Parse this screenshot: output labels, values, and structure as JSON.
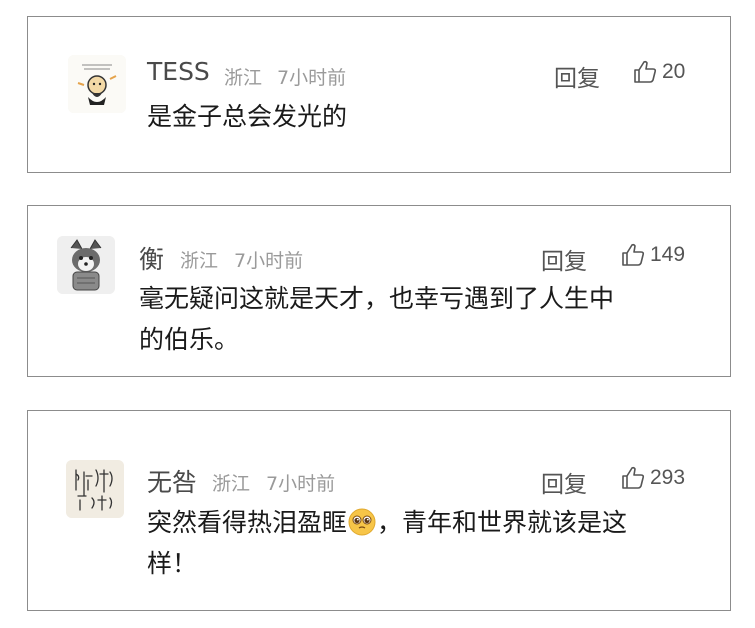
{
  "ui": {
    "reply_label": "回复",
    "like_icon": "thumbs-up-icon",
    "colors": {
      "border": "#8c8c8c",
      "name": "#4a4a4a",
      "meta": "#9a9a9a",
      "text": "#1a1a1a",
      "emoji": "#f7c548"
    }
  },
  "comments": [
    {
      "name": "TESS",
      "location": "浙江",
      "time": "7小时前",
      "likes": "20",
      "avatar_icon": "cartoon-figure-avatar",
      "text_lines": [
        "是金子总会发光的"
      ]
    },
    {
      "name": "衡",
      "location": "浙江",
      "time": "7小时前",
      "likes": "149",
      "avatar_icon": "husky-dog-avatar",
      "text_lines": [
        "毫无疑问这就是天才，也幸亏遇到了人生中",
        "的伯乐。"
      ]
    },
    {
      "name": "无咎",
      "location": "浙江",
      "time": "7小时前",
      "likes": "293",
      "avatar_icon": "calligraphy-avatar",
      "text_lines": [
        "突然看得热泪盈眶",
        "，青年和世界就该是这",
        "样！"
      ],
      "emoji_icon": "pleading-face-emoji-icon"
    }
  ]
}
